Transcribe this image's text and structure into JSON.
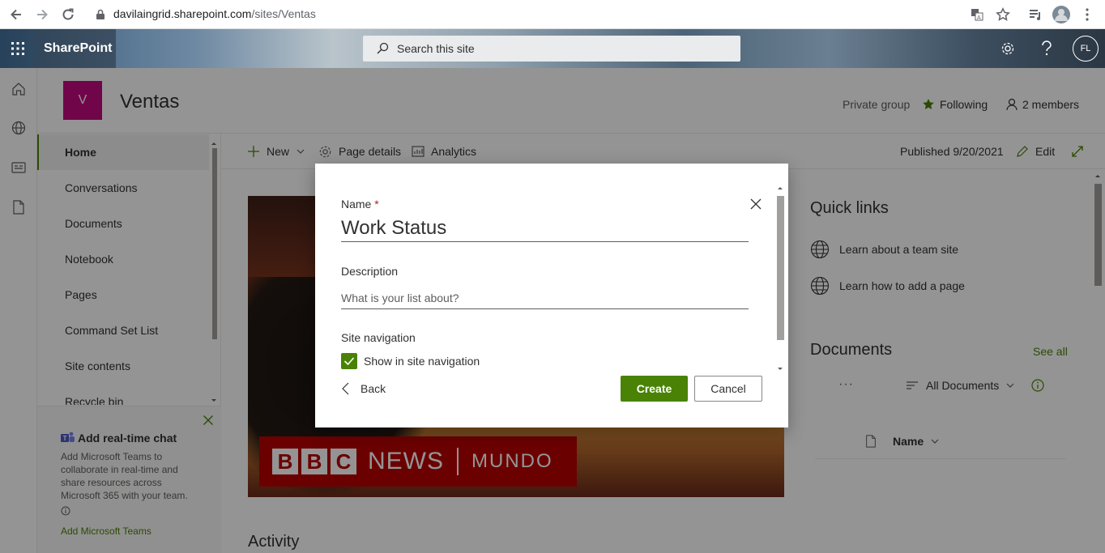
{
  "browser": {
    "url_host": "davilaingrid.sharepoint.com",
    "url_path": "/sites/Ventas",
    "icons": [
      "back-icon",
      "forward-icon",
      "reload-icon",
      "lock-icon",
      "translate-icon",
      "star-icon",
      "playlist-icon",
      "profile-avatar",
      "more-vert-icon"
    ]
  },
  "suite": {
    "brand": "SharePoint",
    "search_placeholder": "Search this site",
    "avatar_initials": "FL"
  },
  "site": {
    "logo_letter": "V",
    "title": "Ventas",
    "privacy": "Private group",
    "following": "Following",
    "members": "2 members"
  },
  "nav": {
    "items": [
      {
        "label": "Home",
        "selected": true
      },
      {
        "label": "Conversations"
      },
      {
        "label": "Documents"
      },
      {
        "label": "Notebook"
      },
      {
        "label": "Pages"
      },
      {
        "label": "Command Set List"
      },
      {
        "label": "Site contents"
      },
      {
        "label": "Recycle bin"
      }
    ]
  },
  "teams_promo": {
    "title": "Add real-time chat",
    "body": "Add Microsoft Teams to collaborate in real-time and share resources across Microsoft 365 with your team.",
    "link": "Add Microsoft Teams"
  },
  "commandbar": {
    "new": "New",
    "page_details": "Page details",
    "analytics": "Analytics",
    "published": "Published 9/20/2021",
    "edit": "Edit"
  },
  "hero": {
    "bbc_letters": [
      "B",
      "B",
      "C"
    ],
    "news": "NEWS",
    "mundo": "MUNDO"
  },
  "activity": "Activity",
  "quick_links": {
    "title": "Quick links",
    "items": [
      "Learn about a team site",
      "Learn how to add a page"
    ]
  },
  "documents": {
    "title": "Documents",
    "see_all": "See all",
    "dots": "···",
    "view": "All Documents",
    "name_col": "Name"
  },
  "dialog": {
    "name_label": "Name",
    "required_mark": "*",
    "name_value": "Work Status",
    "description_label": "Description",
    "description_placeholder": "What is your list about?",
    "site_nav_label": "Site navigation",
    "show_in_nav_label": "Show in site navigation",
    "show_in_nav_checked": true,
    "back": "Back",
    "create": "Create",
    "cancel": "Cancel"
  },
  "colors": {
    "accent": "#498205",
    "site_logo": "#c30a7e",
    "required": "#a4262c"
  }
}
